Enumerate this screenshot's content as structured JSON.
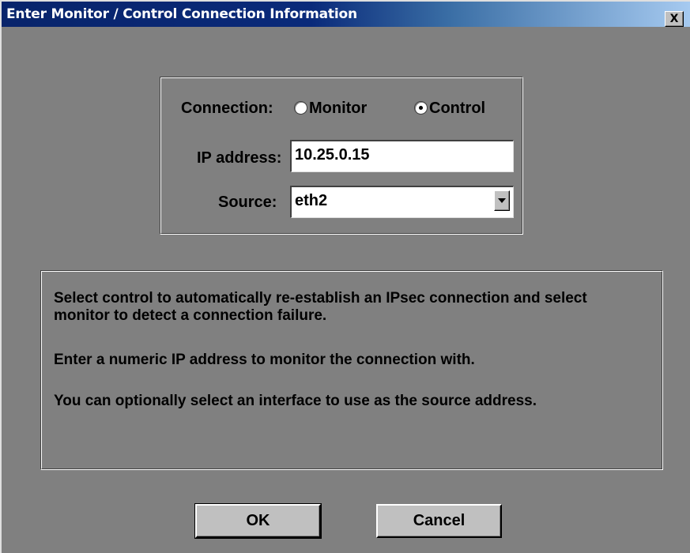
{
  "window": {
    "title": "Enter Monitor / Control Connection Information",
    "close_label": "X"
  },
  "form": {
    "connection_label": "Connection:",
    "connection_options": [
      {
        "label": "Monitor",
        "selected": false
      },
      {
        "label": "Control",
        "selected": true
      }
    ],
    "ip_label": "IP address:",
    "ip_value": "10.25.0.15",
    "source_label": "Source:",
    "source_value": "eth2"
  },
  "help": {
    "paragraph1": "Select control to automatically re-establish an IPsec connection and select monitor to detect a connection failure.",
    "paragraph2": "Enter a numeric IP address to monitor the connection with.",
    "paragraph3": "You can optionally select an interface to use as the source address."
  },
  "buttons": {
    "ok_label": "OK",
    "cancel_label": "Cancel"
  },
  "colors": {
    "dialog_background": "#808080",
    "titlebar_start": "#08246b",
    "titlebar_end": "#a6caf0",
    "title_text": "#ffffff"
  }
}
